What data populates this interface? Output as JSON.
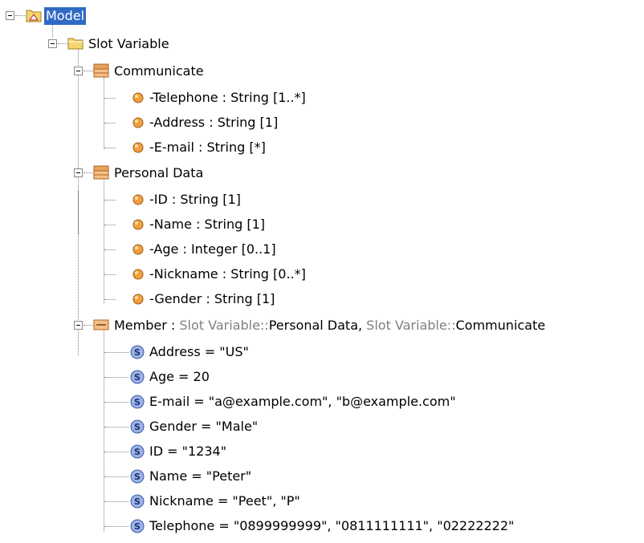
{
  "tree": {
    "model": {
      "label": "Model"
    },
    "slot_variable": {
      "label": "Slot Variable"
    },
    "communicate": {
      "label": "Communicate",
      "attributes": [
        {
          "name": "-Telephone",
          "type": " : String [1..*]"
        },
        {
          "name": "-Address",
          "type": " : String [1]"
        },
        {
          "name": "-E-mail",
          "type": " : String [*]"
        }
      ]
    },
    "personal_data": {
      "label": "Personal Data",
      "attributes": [
        {
          "name": "-ID",
          "type": " : String [1]"
        },
        {
          "name": "-Name",
          "type": " : String [1]"
        },
        {
          "name": "-Age",
          "type": " : Integer [0..1]"
        },
        {
          "name": "-Nickname",
          "type": " : String [0..*]"
        },
        {
          "name": "-Gender",
          "type": " : String [1]"
        }
      ]
    },
    "member": {
      "label": "Member",
      "sep": " : ",
      "classifier1_prefix": "Slot Variable::",
      "classifier1_name": "Personal Data",
      "comma": ", ",
      "classifier2_prefix": "Slot Variable::",
      "classifier2_name": "Communicate",
      "slots": [
        "Address = \"US\"",
        "Age = 20",
        "E-mail = \"a@example.com\", \"b@example.com\"",
        "Gender = \"Male\"",
        "ID = \"1234\"",
        "Name = \"Peter\"",
        "Nickname = \"Peet\", \"P\"",
        "Telephone = \"0899999999\", \"0811111111\", \"02222222\""
      ]
    }
  },
  "colors": {
    "selection": "#316ac5",
    "package_folder": "#f5d670",
    "class_icon": "#e8a25c",
    "attribute_icon": "#f0a040",
    "slot_icon": "#7d9ad6",
    "classifier_prefix": "#7f7f7f"
  },
  "icons": {
    "model": "model-package-icon",
    "package": "folder-icon",
    "class": "class-icon",
    "attribute": "attribute-icon",
    "instance": "instance-specification-icon",
    "slot": "slot-icon"
  }
}
